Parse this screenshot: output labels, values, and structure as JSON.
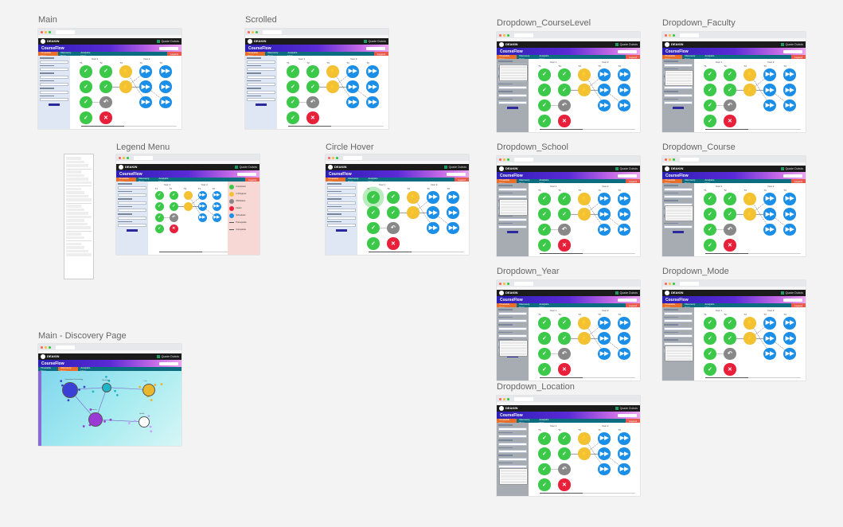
{
  "canvas": {
    "background": "#f3f3f3"
  },
  "frames": {
    "main": {
      "title": "Main"
    },
    "scrolled": {
      "title": "Scrolled"
    },
    "dd_course_level": {
      "title": "Dropdown_CourseLevel"
    },
    "dd_faculty": {
      "title": "Dropdown_Faculty"
    },
    "legend_menu": {
      "title": "Legend Menu"
    },
    "circle_hover": {
      "title": "Circle Hover"
    },
    "dd_school": {
      "title": "Dropdown_School"
    },
    "dd_course": {
      "title": "Dropdown_Course"
    },
    "dd_year": {
      "title": "Dropdown_Year"
    },
    "dd_mode": {
      "title": "Dropdown_Mode"
    },
    "dd_location": {
      "title": "Dropdown_Location"
    },
    "discovery": {
      "title": "Main - Discovery Page"
    }
  },
  "app": {
    "name": "CourseFlow",
    "logo": "DEAKIN UNIVERSITY",
    "user": "Quade Dubois",
    "tabs": [
      "Timetable View",
      "Discovery Page",
      "Analytics View"
    ],
    "legend_button": "Legend",
    "year1": "Year 1",
    "year2": "Year 2",
    "tri": [
      "T1",
      "T2",
      "T3",
      "T1",
      "T2",
      "T3"
    ]
  },
  "colors": {
    "complete": "#3cc94a",
    "in_progress": "#f3c234",
    "available": "#1b8fe8",
    "repeat": "#888888",
    "failed": "#e8203a",
    "header_gradient_start": "#2b1fb5",
    "tab_bar": "#0b6d7f",
    "active_tab": "#e86f2a"
  },
  "legend": {
    "items": [
      "Completed",
      "In Progress",
      "Withdrawn",
      "Failed",
      "Scheduled",
      "Prerequisite",
      "Corequisite"
    ]
  },
  "discovery": {
    "nodes": [
      "Information Technology",
      "Education",
      "Law",
      "Science",
      "Health"
    ]
  },
  "icons": {
    "complete": "check-icon",
    "progress": "bolt-icon",
    "available": "fast-forward-icon",
    "repeat": "undo-icon",
    "failed": "x-icon"
  }
}
